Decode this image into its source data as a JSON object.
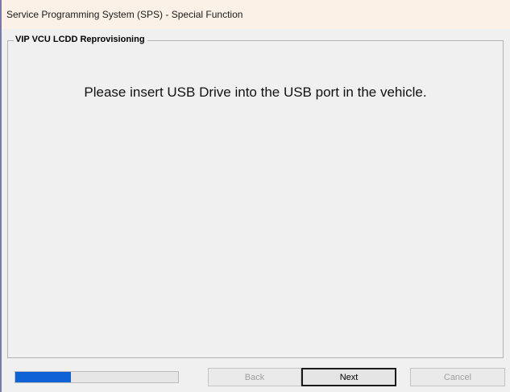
{
  "window": {
    "title": "Service Programming System (SPS) - Special Function"
  },
  "group": {
    "legend": "VIP VCU LCDD Reprovisioning"
  },
  "message": "Please insert USB Drive into the USB port in the vehicle.",
  "progress": {
    "fraction": 0.34,
    "color": "#0f62d6"
  },
  "buttons": {
    "back": "Back",
    "next": "Next",
    "cancel": "Cancel"
  }
}
